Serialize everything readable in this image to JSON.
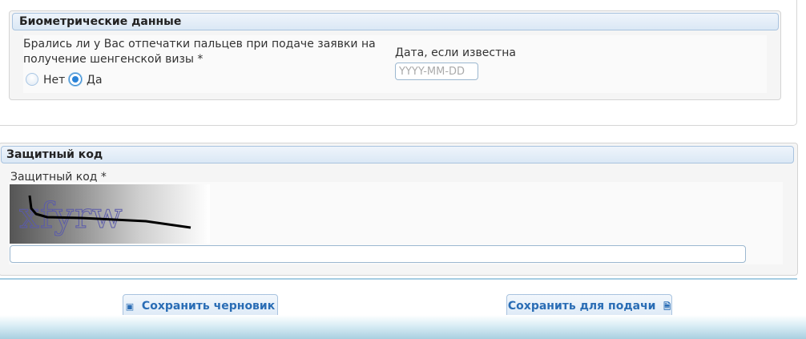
{
  "biometrics": {
    "header": "Биометрические данные",
    "question": "Брались ли у Вас отпечатки пальцев при подаче заявки на получение шенгенской визы *",
    "options": [
      {
        "label": "Нет",
        "selected": false
      },
      {
        "label": "Да",
        "selected": true
      }
    ],
    "date_label": "Дата, если известна",
    "date_placeholder": "YYYY-MM-DD",
    "date_value": ""
  },
  "security": {
    "header": "Защитный код",
    "label": "Защитный код *",
    "captcha_text": "xfyrw",
    "input_value": ""
  },
  "actions": {
    "save_draft": "Сохранить черновик",
    "save_submit": "Сохранить для подачи",
    "save_draft_icon": "floppy-icon",
    "save_submit_icon": "document-icon"
  },
  "colors": {
    "header_border": "#a9c3df",
    "button_text": "#2a6db5",
    "radio_selected": "#2a83d8"
  }
}
